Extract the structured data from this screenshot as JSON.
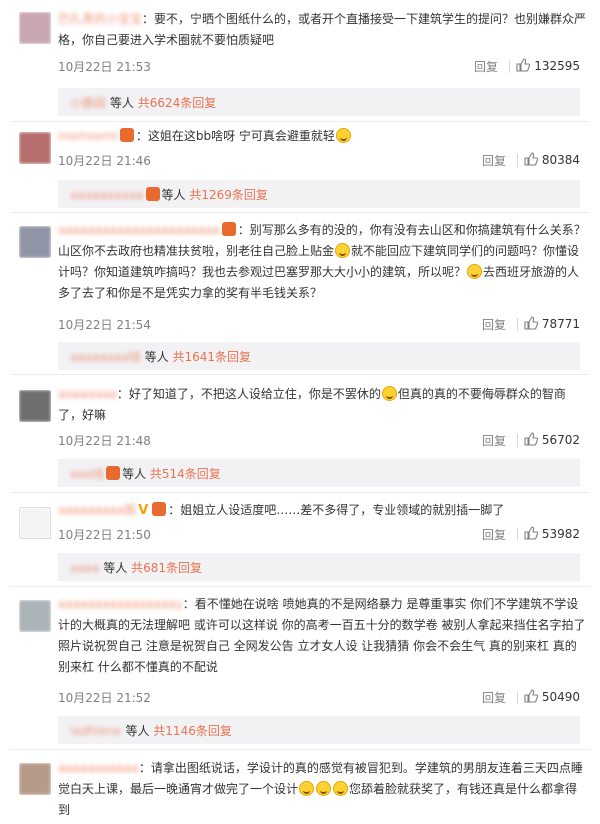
{
  "comments": [
    {
      "nick": "巴扎黑的小宝宝",
      "text": "：要不，宁晒个图纸什么的，或者开个直播接受一下建筑学生的提问？也别嫌群众严格，你自己要进入学术圈就不要怕质疑吧",
      "time": "10月22日 21:53",
      "reply": "回复",
      "likes": "132595",
      "sub_name": "小鹿超",
      "sub_people": "等人",
      "sub_count": "共6624条回复",
      "avatar_color": "#c9a7b0"
    },
    {
      "nick": "momoxml",
      "text": "：这姐在这bb啥呀  宁可真会避重就轻",
      "time": "10月22日 21:46",
      "reply": "回复",
      "likes": "80384",
      "sub_name": "aaaaaaaaaa",
      "sub_people": "等人",
      "sub_count": "共1269条回复",
      "avatar_color": "#b76d6d"
    },
    {
      "nick": "aaaaaaaaaaaaaaaaaaaaaa",
      "text_a": "：别写那么多有的没的，你有没有去山区和你搞建筑有什么关系？山区你不去政府也精准扶贫啦，别老往自己脸上贴金",
      "text_b": "就不能回应下建筑同学们的问题吗？你懂设计吗？你知道建筑咋搞吗？我也去参观过巴塞罗那大大小小的建筑，所以呢？",
      "text_c": "去西班牙旅游的人多了去了和你是不是凭实力拿的奖有半毛钱关系？",
      "time": "10月22日 21:54",
      "reply": "回复",
      "likes": "78771",
      "sub_name": "aaaaaaaa钱",
      "sub_people": "等人",
      "sub_count": "共1641条回复",
      "avatar_color": "#8f94a6"
    },
    {
      "nick": "aaaaaaaa",
      "text_a": "：好了知道了，不把这人设给立住，你是不罢休的",
      "text_b": "但真的真的不要侮辱群众的智商了，好嘛",
      "time": "10月22日 21:48",
      "reply": "回复",
      "likes": "56702",
      "sub_name": "aaa线",
      "sub_people": "等人",
      "sub_count": "共514条回复",
      "avatar_color": "#6e6e6e"
    },
    {
      "nick": "aaaaaaaaa图",
      "text": "：姐姐立人设适度吧……差不多得了，专业领域的就别插一脚了",
      "time": "10月22日 21:50",
      "reply": "回复",
      "likes": "53982",
      "sub_name": "aaaa",
      "sub_people": "等人",
      "sub_count": "共681条回复",
      "avatar_color": "#f3f3f3"
    },
    {
      "nick": "aaaaaaaaaaaaaaaay",
      "text": "：看不懂她在说啥 喷她真的不是网络暴力 是尊重事实 你们不学建筑不学设计的大概真的无法理解吧 或许可以这样说 你的高考一百五十分的数学卷 被别人拿起来挡住名字拍了照片说祝贺自己 注意是祝贺自己 全网发公告 立才女人设 让我猜猜 你会不会生气 真的别来杠 真的别来杠 什么都不懂真的不配说",
      "time": "10月22日 21:52",
      "reply": "回复",
      "likes": "50490",
      "sub_name": "ladhlene",
      "sub_people": "等人",
      "sub_count": "共1146条回复",
      "avatar_color": "#a9b3b8"
    },
    {
      "nick": "aaaaaaaaaaa",
      "text_a": "：请拿出图纸说话，学设计的真的感觉有被冒犯到。学建筑的男朋友连着三天四点睡觉白天上课，最后一晚通宵才做完了一个设计",
      "text_b": "您舔着脸就获奖了，有钱还真是什么都拿得到",
      "avatar_color": "#b59a8a"
    }
  ]
}
